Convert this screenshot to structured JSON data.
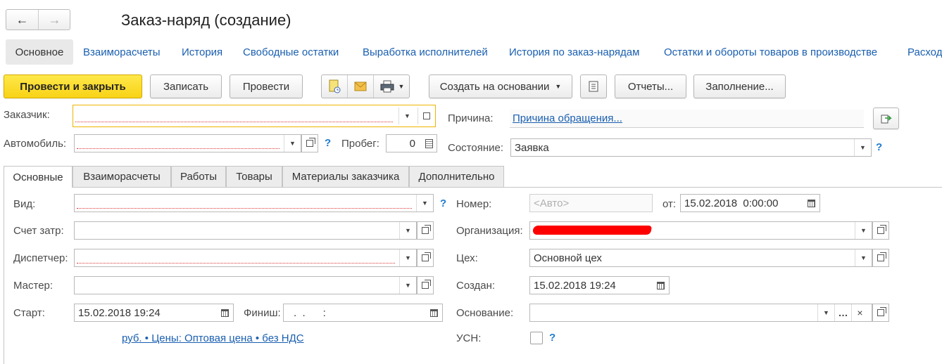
{
  "window": {
    "title": "Заказ-наряд (создание)"
  },
  "nav": {
    "tabs": [
      {
        "label": "Основное"
      },
      {
        "label": "Взаиморасчеты"
      },
      {
        "label": "История"
      },
      {
        "label": "Свободные остатки"
      },
      {
        "label": "Выработка исполнителей"
      },
      {
        "label": "История по заказ-нарядам"
      },
      {
        "label": "Остатки и обороты товаров в производстве"
      },
      {
        "label": "Расход"
      }
    ]
  },
  "toolbar": {
    "post_close": "Провести и закрыть",
    "save": "Записать",
    "post": "Провести",
    "create_based": "Создать на основании",
    "reports": "Отчеты...",
    "fill": "Заполнение..."
  },
  "header": {
    "customer_label": "Заказчик:",
    "car_label": "Автомобиль:",
    "mileage_label": "Пробег:",
    "mileage_value": "0",
    "reason_label": "Причина:",
    "reason_link": "Причина обращения...",
    "state_label": "Состояние:",
    "state_value": "Заявка",
    "help": "?"
  },
  "tabs": [
    {
      "label": "Основные"
    },
    {
      "label": "Взаиморасчеты"
    },
    {
      "label": "Работы"
    },
    {
      "label": "Товары"
    },
    {
      "label": "Материалы заказчика"
    },
    {
      "label": "Дополнительно"
    }
  ],
  "form": {
    "kind_label": "Вид:",
    "cost_account_label": "Счет затр:",
    "dispatcher_label": "Диспетчер:",
    "master_label": "Мастер:",
    "start_label": "Старт:",
    "start_value": "15.02.2018 19:24",
    "finish_label": "Финиш:",
    "finish_value": ".  .      :",
    "prices_link": "руб. • Цены: Оптовая цена • без НДС",
    "number_label": "Номер:",
    "number_placeholder": "<Авто>",
    "from_label": "от:",
    "date_value": "15.02.2018  0:00:00",
    "org_label": "Организация:",
    "workshop_label": "Цех:",
    "workshop_value": "Основной цех",
    "created_label": "Создан:",
    "created_value": "15.02.2018 19:24",
    "basis_label": "Основание:",
    "usn_label": "УСН:",
    "help": "?"
  },
  "colors": {
    "primary_button": "#f8d316",
    "link": "#1a5fb0",
    "help": "#1f7bcf",
    "focus_border": "#f0b400",
    "redaction": "#ff0000"
  }
}
